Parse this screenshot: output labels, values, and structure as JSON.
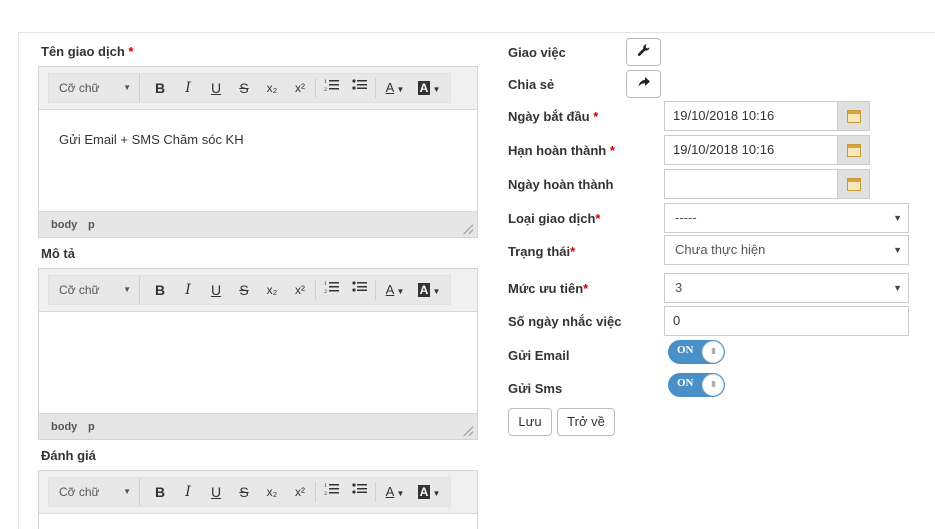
{
  "form": {
    "ten_label": "Tên giao dịch",
    "mota_label": "Mô tả",
    "danhgia_label": "Đánh giá",
    "required_mark": "*"
  },
  "editor": {
    "font_placeholder": "Cỡ chữ",
    "content_ten": "Gửi Email + SMS Chăm sóc KH",
    "path_body": "body",
    "path_p": "p",
    "tools": {
      "bold": "B",
      "italic": "I",
      "underline": "U",
      "strike": "S",
      "subscript": "x₂",
      "superscript": "x²"
    }
  },
  "right": {
    "giaoviec": "Giao việc",
    "chiase": "Chia sẻ",
    "ngaybatdau": "Ngày bắt đầu",
    "ngaybatdau_value": "19/10/2018 10:16",
    "hanhoanthanh": "Hạn hoàn thành",
    "hanhoanthanh_value": "19/10/2018 10:16",
    "ngayhoanthanh": "Ngày hoàn thành",
    "ngayhoanthanh_value": "",
    "loaigiaodich": "Loại giao dịch",
    "loaigiaodich_value": "-----",
    "trangthai": "Trạng thái",
    "trangthai_value": "Chưa thực hiện",
    "mucuutien": "Mức ưu tiên",
    "mucuutien_value": "3",
    "songaynhacviec": "Số ngày nhắc việc",
    "songaynhacviec_value": "0",
    "guiemail": "Gửi Email",
    "guisms": "Gửi Sms",
    "toggle_on": "ON",
    "save_btn": "Lưu",
    "back_btn": "Trở về"
  },
  "icons": {
    "giaoviec": "wrench-icon",
    "chiase": "share-arrow-icon",
    "calendar": "calendar-icon"
  },
  "colors": {
    "required": "#cc0000",
    "toggle_on": "#4a90c8"
  }
}
